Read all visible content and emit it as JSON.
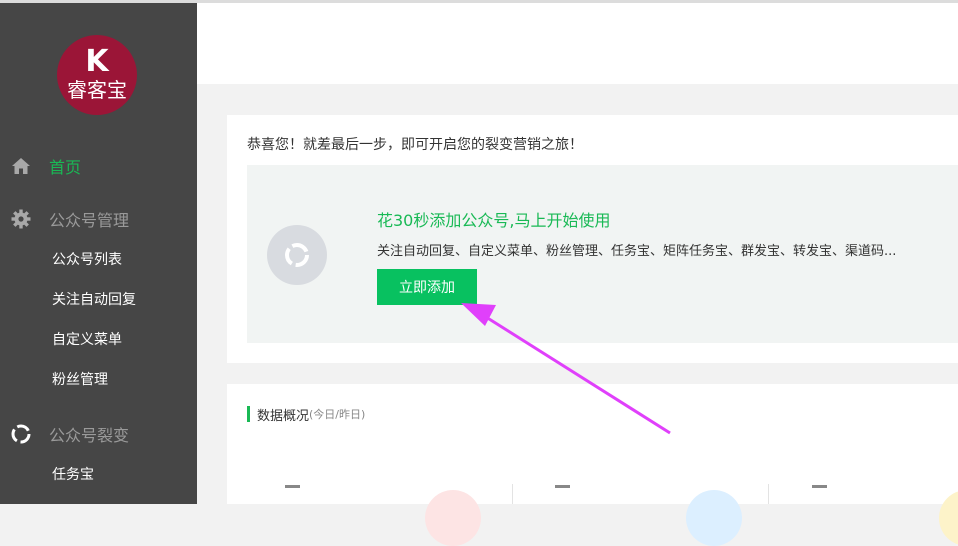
{
  "app": {
    "brand": "睿客宝",
    "logo_mark": "K"
  },
  "sidebar": {
    "nav": [
      {
        "label": "首页",
        "icon": "home-icon",
        "active": true
      }
    ],
    "section_manage": {
      "label": "公众号管理",
      "icon": "gear-icon",
      "items": [
        "公众号列表",
        "关注自动回复",
        "自定义菜单",
        "粉丝管理"
      ]
    },
    "section_fission": {
      "label": "公众号裂变",
      "icon": "fission-icon",
      "items": [
        "任务宝"
      ]
    }
  },
  "onboarding": {
    "congrats_text": "恭喜您！就差最后一步，即可开启您的裂变营销之旅！",
    "card_title": "花30秒添加公众号,马上开始使用",
    "card_desc": "关注自动回复、自定义菜单、粉丝管理、任务宝、矩阵任务宝、群发宝、转发宝、渠道码...",
    "add_button": "立即添加"
  },
  "overview": {
    "title": "数据概况",
    "subtitle": "(今日/昨日)"
  },
  "colors": {
    "sidebar_bg": "#464646",
    "accent_green": "#19b955",
    "button_green": "#08c160",
    "logo_red": "#9b1537",
    "annotation_arrow": "#e040fb"
  }
}
